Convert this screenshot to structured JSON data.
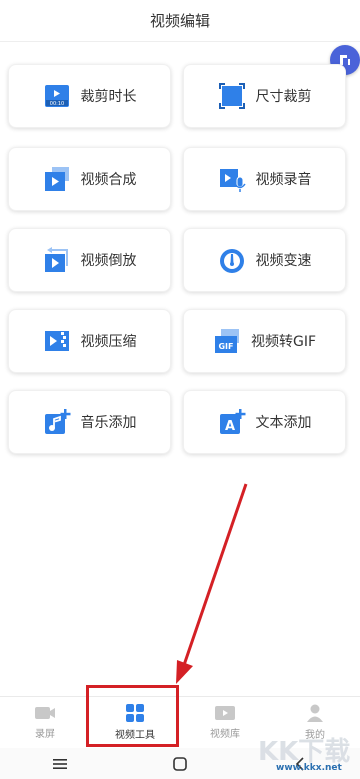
{
  "header": {
    "title": "视频编辑"
  },
  "tiles": [
    {
      "label": "裁剪时长",
      "icon": "trim-duration-icon",
      "icon_text": "00:10"
    },
    {
      "label": "尺寸裁剪",
      "icon": "crop-size-icon"
    },
    {
      "label": "视频合成",
      "icon": "video-merge-icon"
    },
    {
      "label": "视频录音",
      "icon": "video-record-audio-icon"
    },
    {
      "label": "视频倒放",
      "icon": "video-reverse-icon"
    },
    {
      "label": "视频变速",
      "icon": "speed-gauge-icon"
    },
    {
      "label": "视频压缩",
      "icon": "video-compress-icon"
    },
    {
      "label": "视频转GIF",
      "icon": "gif-convert-icon",
      "icon_text": "GIF"
    },
    {
      "label": "音乐添加",
      "icon": "music-add-icon"
    },
    {
      "label": "文本添加",
      "icon": "text-add-icon",
      "icon_text": "A"
    }
  ],
  "tabbar": {
    "tabs": [
      {
        "label": "录屏",
        "icon": "screen-record-icon",
        "active": false
      },
      {
        "label": "视频工具",
        "icon": "video-tools-icon",
        "active": true
      },
      {
        "label": "视频库",
        "icon": "video-library-icon",
        "active": false
      },
      {
        "label": "我的",
        "icon": "profile-icon",
        "active": false
      }
    ]
  },
  "colors": {
    "accent": "#2f80e8",
    "highlight": "#d42025",
    "badge": "#4a63d9"
  },
  "watermark": {
    "brand": "KK下载",
    "url": "www.kkx.net"
  }
}
